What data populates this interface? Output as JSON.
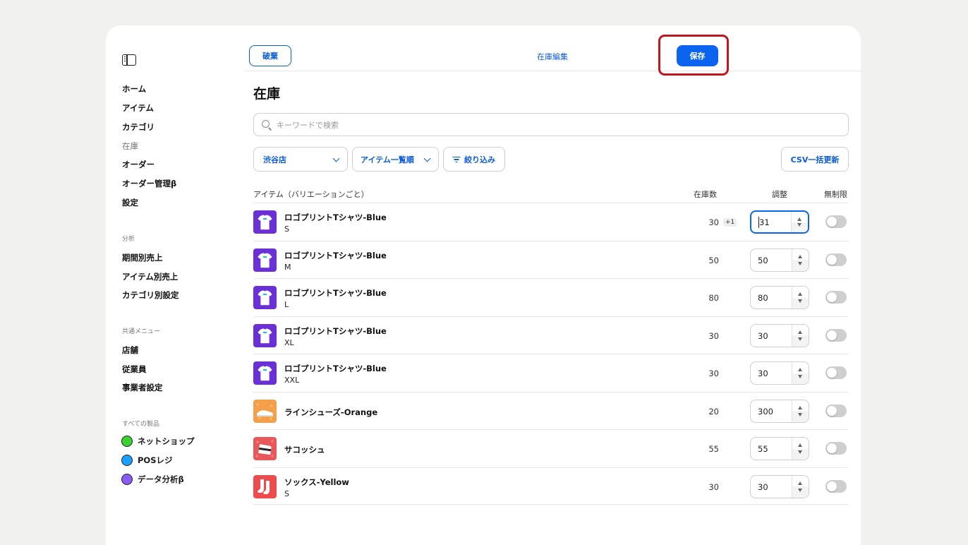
{
  "sidebar": {
    "nav": [
      {
        "label": "ホーム"
      },
      {
        "label": "アイテム"
      },
      {
        "label": "カテゴリ"
      },
      {
        "label": "在庫"
      },
      {
        "label": "オーダー"
      },
      {
        "label": "オーダー管理β"
      },
      {
        "label": "設定"
      }
    ],
    "analysis_label": "分析",
    "analysis": [
      {
        "label": "期間別売上"
      },
      {
        "label": "アイテム別売上"
      },
      {
        "label": "カテゴリ別設定"
      }
    ],
    "common_label": "共通メニュー",
    "common": [
      {
        "label": "店舗"
      },
      {
        "label": "従業員"
      },
      {
        "label": "事業者設定"
      }
    ],
    "products_label": "すべての製品",
    "products": [
      {
        "label": "ネットショップ",
        "color": "#3bd12f"
      },
      {
        "label": "POSレジ",
        "color": "#1aa1ff"
      },
      {
        "label": "データ分析β",
        "color": "#8a5cf5"
      }
    ]
  },
  "header": {
    "discard_label": "破棄",
    "title": "在庫編集",
    "save_label": "保存"
  },
  "page_title": "在庫",
  "search": {
    "placeholder": "キーワードで検索",
    "value": ""
  },
  "filters": {
    "store": "渋谷店",
    "sort": "アイテム一覧順",
    "narrow": "絞り込み",
    "csv": "CSV一括更新"
  },
  "table": {
    "headers": {
      "item": "アイテム（バリエーションごと）",
      "stock": "在庫数",
      "adjust": "調整",
      "unlimited": "無制限"
    },
    "rows": [
      {
        "name": "ロゴプリントTシャツ-Blue",
        "variant": "S",
        "stock": "30",
        "delta": "+1",
        "adjust": "31",
        "thumb": "tshirt-icon"
      },
      {
        "name": "ロゴプリントTシャツ-Blue",
        "variant": "M",
        "stock": "50",
        "delta": "",
        "adjust": "50",
        "thumb": "tshirt-icon"
      },
      {
        "name": "ロゴプリントTシャツ-Blue",
        "variant": "L",
        "stock": "80",
        "delta": "",
        "adjust": "80",
        "thumb": "tshirt-icon"
      },
      {
        "name": "ロゴプリントTシャツ-Blue",
        "variant": "XL",
        "stock": "30",
        "delta": "",
        "adjust": "30",
        "thumb": "tshirt-icon"
      },
      {
        "name": "ロゴプリントTシャツ-Blue",
        "variant": "XXL",
        "stock": "30",
        "delta": "",
        "adjust": "30",
        "thumb": "tshirt-icon"
      },
      {
        "name": "ラインシューズ-Orange",
        "variant": "",
        "stock": "20",
        "delta": "",
        "adjust": "300",
        "thumb": "shoe-icon"
      },
      {
        "name": "サコッシュ",
        "variant": "",
        "stock": "55",
        "delta": "",
        "adjust": "55",
        "thumb": "bag-icon"
      },
      {
        "name": "ソックス-Yellow",
        "variant": "S",
        "stock": "30",
        "delta": "",
        "adjust": "30",
        "thumb": "socks-icon"
      }
    ]
  },
  "colors": {
    "accent": "#0a64f0",
    "highlight": "#c0161e"
  }
}
